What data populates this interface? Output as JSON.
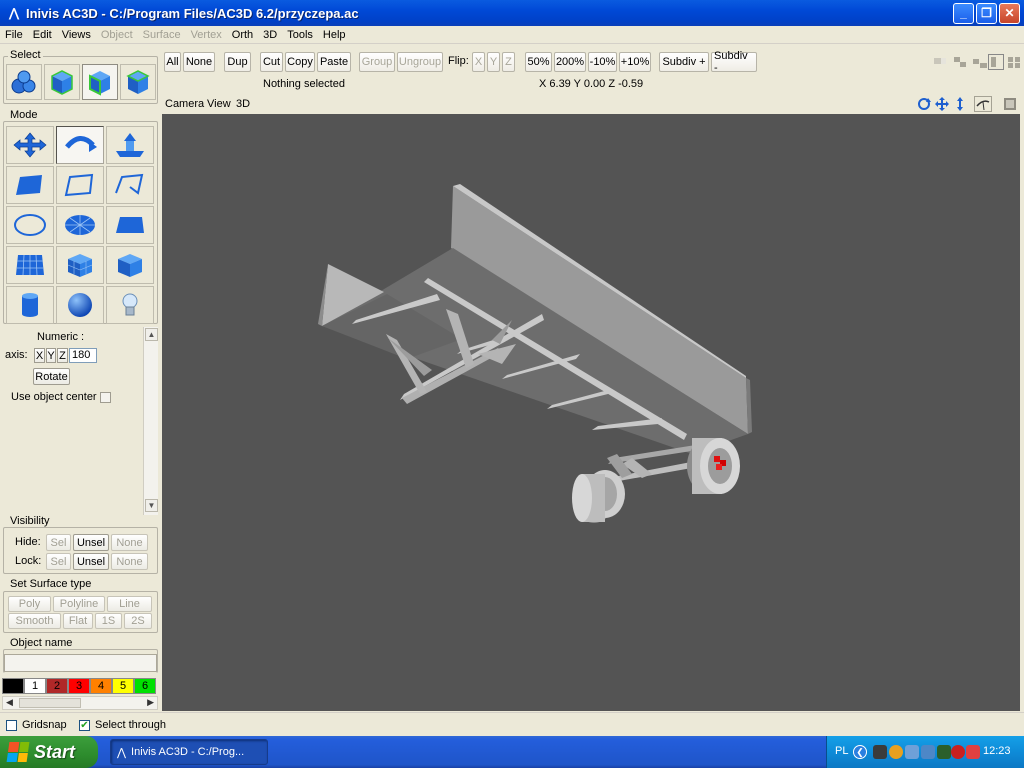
{
  "window": {
    "title": "Inivis AC3D - C:/Program Files/AC3D 6.2/przyczepa.ac",
    "min": "_",
    "max": "❐",
    "close": "✕"
  },
  "menu": [
    {
      "label": "File",
      "enabled": true
    },
    {
      "label": "Edit",
      "enabled": true
    },
    {
      "label": "Views",
      "enabled": true
    },
    {
      "label": "Object",
      "enabled": false
    },
    {
      "label": "Surface",
      "enabled": false
    },
    {
      "label": "Vertex",
      "enabled": false
    },
    {
      "label": "Orth",
      "enabled": true
    },
    {
      "label": "3D",
      "enabled": true
    },
    {
      "label": "Tools",
      "enabled": true
    },
    {
      "label": "Help",
      "enabled": true
    }
  ],
  "left": {
    "select_label": "Select",
    "mode_label": "Mode",
    "numeric_label": "Numeric :",
    "axis_label": "axis:",
    "axis_x": "X",
    "axis_y": "Y",
    "axis_z": "Z",
    "axis_value": "180",
    "rotate_label": "Rotate",
    "use_center_label": "Use object center",
    "visibility_label": "Visibility",
    "hide_label": "Hide:",
    "lock_label": "Lock:",
    "sel": "Sel",
    "unsel": "Unsel",
    "none": "None",
    "surface_label": "Set Surface type",
    "poly": "Poly",
    "polyline": "Polyline",
    "line": "Line",
    "smooth": "Smooth",
    "flat": "Flat",
    "one_s": "1S",
    "two_s": "2S",
    "objname_label": "Object name",
    "palette": [
      {
        "label": "",
        "color": "#000000",
        "text": "#ffffff"
      },
      {
        "label": "1",
        "color": "#ffffff",
        "text": "#000000"
      },
      {
        "label": "2",
        "color": "#B02828",
        "text": "#000000"
      },
      {
        "label": "3",
        "color": "#FF0000",
        "text": "#000000"
      },
      {
        "label": "4",
        "color": "#FF8000",
        "text": "#000000"
      },
      {
        "label": "5",
        "color": "#FFFF00",
        "text": "#000000"
      },
      {
        "label": "6",
        "color": "#00E000",
        "text": "#000000"
      }
    ]
  },
  "toolbar": {
    "all": "All",
    "none": "None",
    "dup": "Dup",
    "cut": "Cut",
    "copy": "Copy",
    "paste": "Paste",
    "group": "Group",
    "ungroup": "Ungroup",
    "flip": "Flip:",
    "fx": "X",
    "fy": "Y",
    "fz": "Z",
    "p50": "50%",
    "p200": "200%",
    "m10": "-10%",
    "p10": "+10%",
    "subdiv_plus": "Subdiv +",
    "subdiv_minus": "Subdiv -",
    "status": "Nothing selected",
    "coords": "X 6.39 Y 0.00 Z -0.59"
  },
  "viewport": {
    "label_camera": "Camera",
    "label_view": "View",
    "label_3d": "3D",
    "background": "#545454"
  },
  "bottom": {
    "gridsnap": "Gridsnap",
    "select_through": "Select through",
    "gridsnap_checked": false,
    "select_through_checked": true
  },
  "taskbar": {
    "start": "Start",
    "task": "Inivis AC3D - C:/Prog...",
    "lang": "PL",
    "clock": "12:23"
  }
}
